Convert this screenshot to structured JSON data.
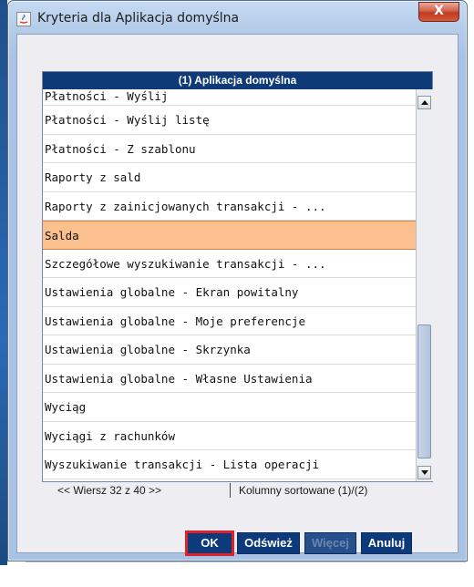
{
  "window": {
    "title": "Kryteria dla Aplikacja domyślna",
    "close_label": "X"
  },
  "list": {
    "header": "(1) Aplikacja domyślna",
    "rows": [
      "Płatności - Wyślij",
      "Płatności - Wyślij listę",
      "Płatności - Z szablonu",
      "Raporty z sald",
      "Raporty z zainicjowanych transakcji - ...",
      "Salda",
      "Szczegółowe wyszukiwanie transakcji - ...",
      "Ustawienia globalne - Ekran powitalny",
      "Ustawienia globalne - Moje preferencje",
      "Ustawienia globalne - Skrzynka",
      "Ustawienia globalne - Własne Ustawienia",
      "Wyciąg",
      "Wyciągi z rachunków",
      "Wyszukiwanie transakcji - Lista operacji"
    ],
    "selected_row": "Salda"
  },
  "status": {
    "row_position": "<< Wiersz 32 z 40 >>",
    "sort_info": "Kolumny sortowane (1)/(2)"
  },
  "buttons": {
    "ok": "OK",
    "refresh": "Odśwież",
    "more": "Więcej",
    "cancel": "Anuluj"
  },
  "colors": {
    "header_bg": "#0e3a78",
    "selected_bg": "#fbc08e",
    "button_bg": "#0d3a7a",
    "highlight_outline": "#e0202a"
  }
}
